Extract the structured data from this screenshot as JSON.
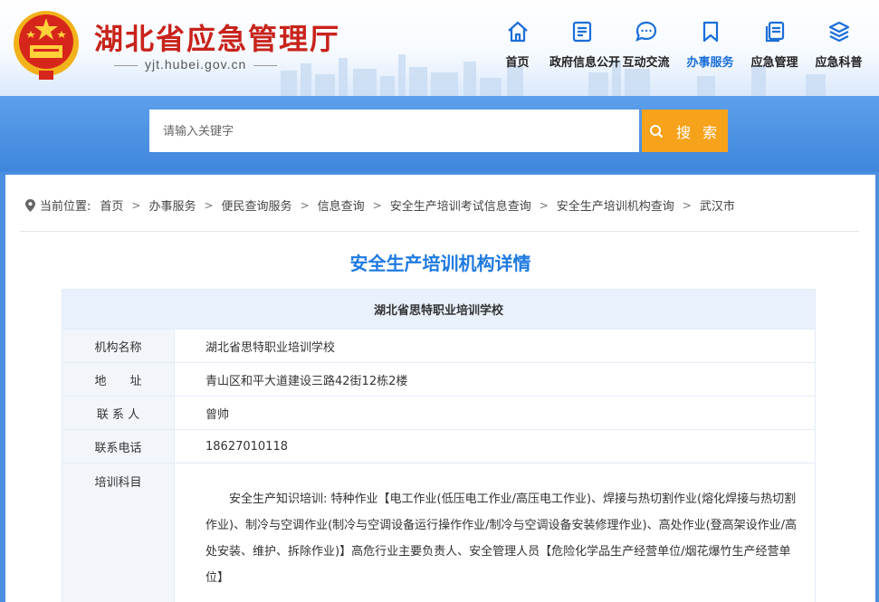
{
  "header": {
    "site_title": "湖北省应急管理厅",
    "site_domain": "yjt.hubei.gov.cn"
  },
  "nav": [
    {
      "label": "首页",
      "icon": "home-icon"
    },
    {
      "label": "政府信息公开",
      "icon": "document-icon"
    },
    {
      "label": "互动交流",
      "icon": "chat-bubble-icon"
    },
    {
      "label": "办事服务",
      "icon": "bookmark-icon",
      "active": true
    },
    {
      "label": "应急管理",
      "icon": "files-icon"
    },
    {
      "label": "应急科普",
      "icon": "layers-icon"
    }
  ],
  "search": {
    "placeholder": "请输入关键字",
    "button_label": "搜 索"
  },
  "breadcrumb": {
    "label": "当前位置:",
    "items": [
      "首页",
      "办事服务",
      "便民查询服务",
      "信息查询",
      "安全生产培训考试信息查询",
      "安全生产培训机构查询",
      "武汉市"
    ]
  },
  "page_title": "安全生产培训机构详情",
  "detail": {
    "header": "湖北省思特职业培训学校",
    "rows": [
      {
        "label": "机构名称",
        "value": "湖北省思特职业培训学校"
      },
      {
        "label": "地　　址",
        "value": "青山区和平大道建设三路42街12栋2楼"
      },
      {
        "label": "联 系 人",
        "value": "曾帅"
      },
      {
        "label": "联系电话",
        "value": "18627010118"
      }
    ],
    "subject_label": "培训科目",
    "subject_value": "安全生产知识培训: 特种作业【电工作业(低压电工作业/高压电工作业)、焊接与热切割作业(熔化焊接与热切割作业)、制冷与空调作业(制冷与空调设备运行操作作业/制冷与空调设备安装修理作业)、高处作业(登高架设作业/高处安装、维护、拆除作业)】高危行业主要负责人、安全管理人员【危险化学品生产经营单位/烟花爆竹生产经营单位】"
  },
  "colors": {
    "title_red": "#c8231b",
    "accent_blue": "#1f7ae0",
    "search_orange": "#f6a21a",
    "band_blue": "#4a8fe0"
  }
}
